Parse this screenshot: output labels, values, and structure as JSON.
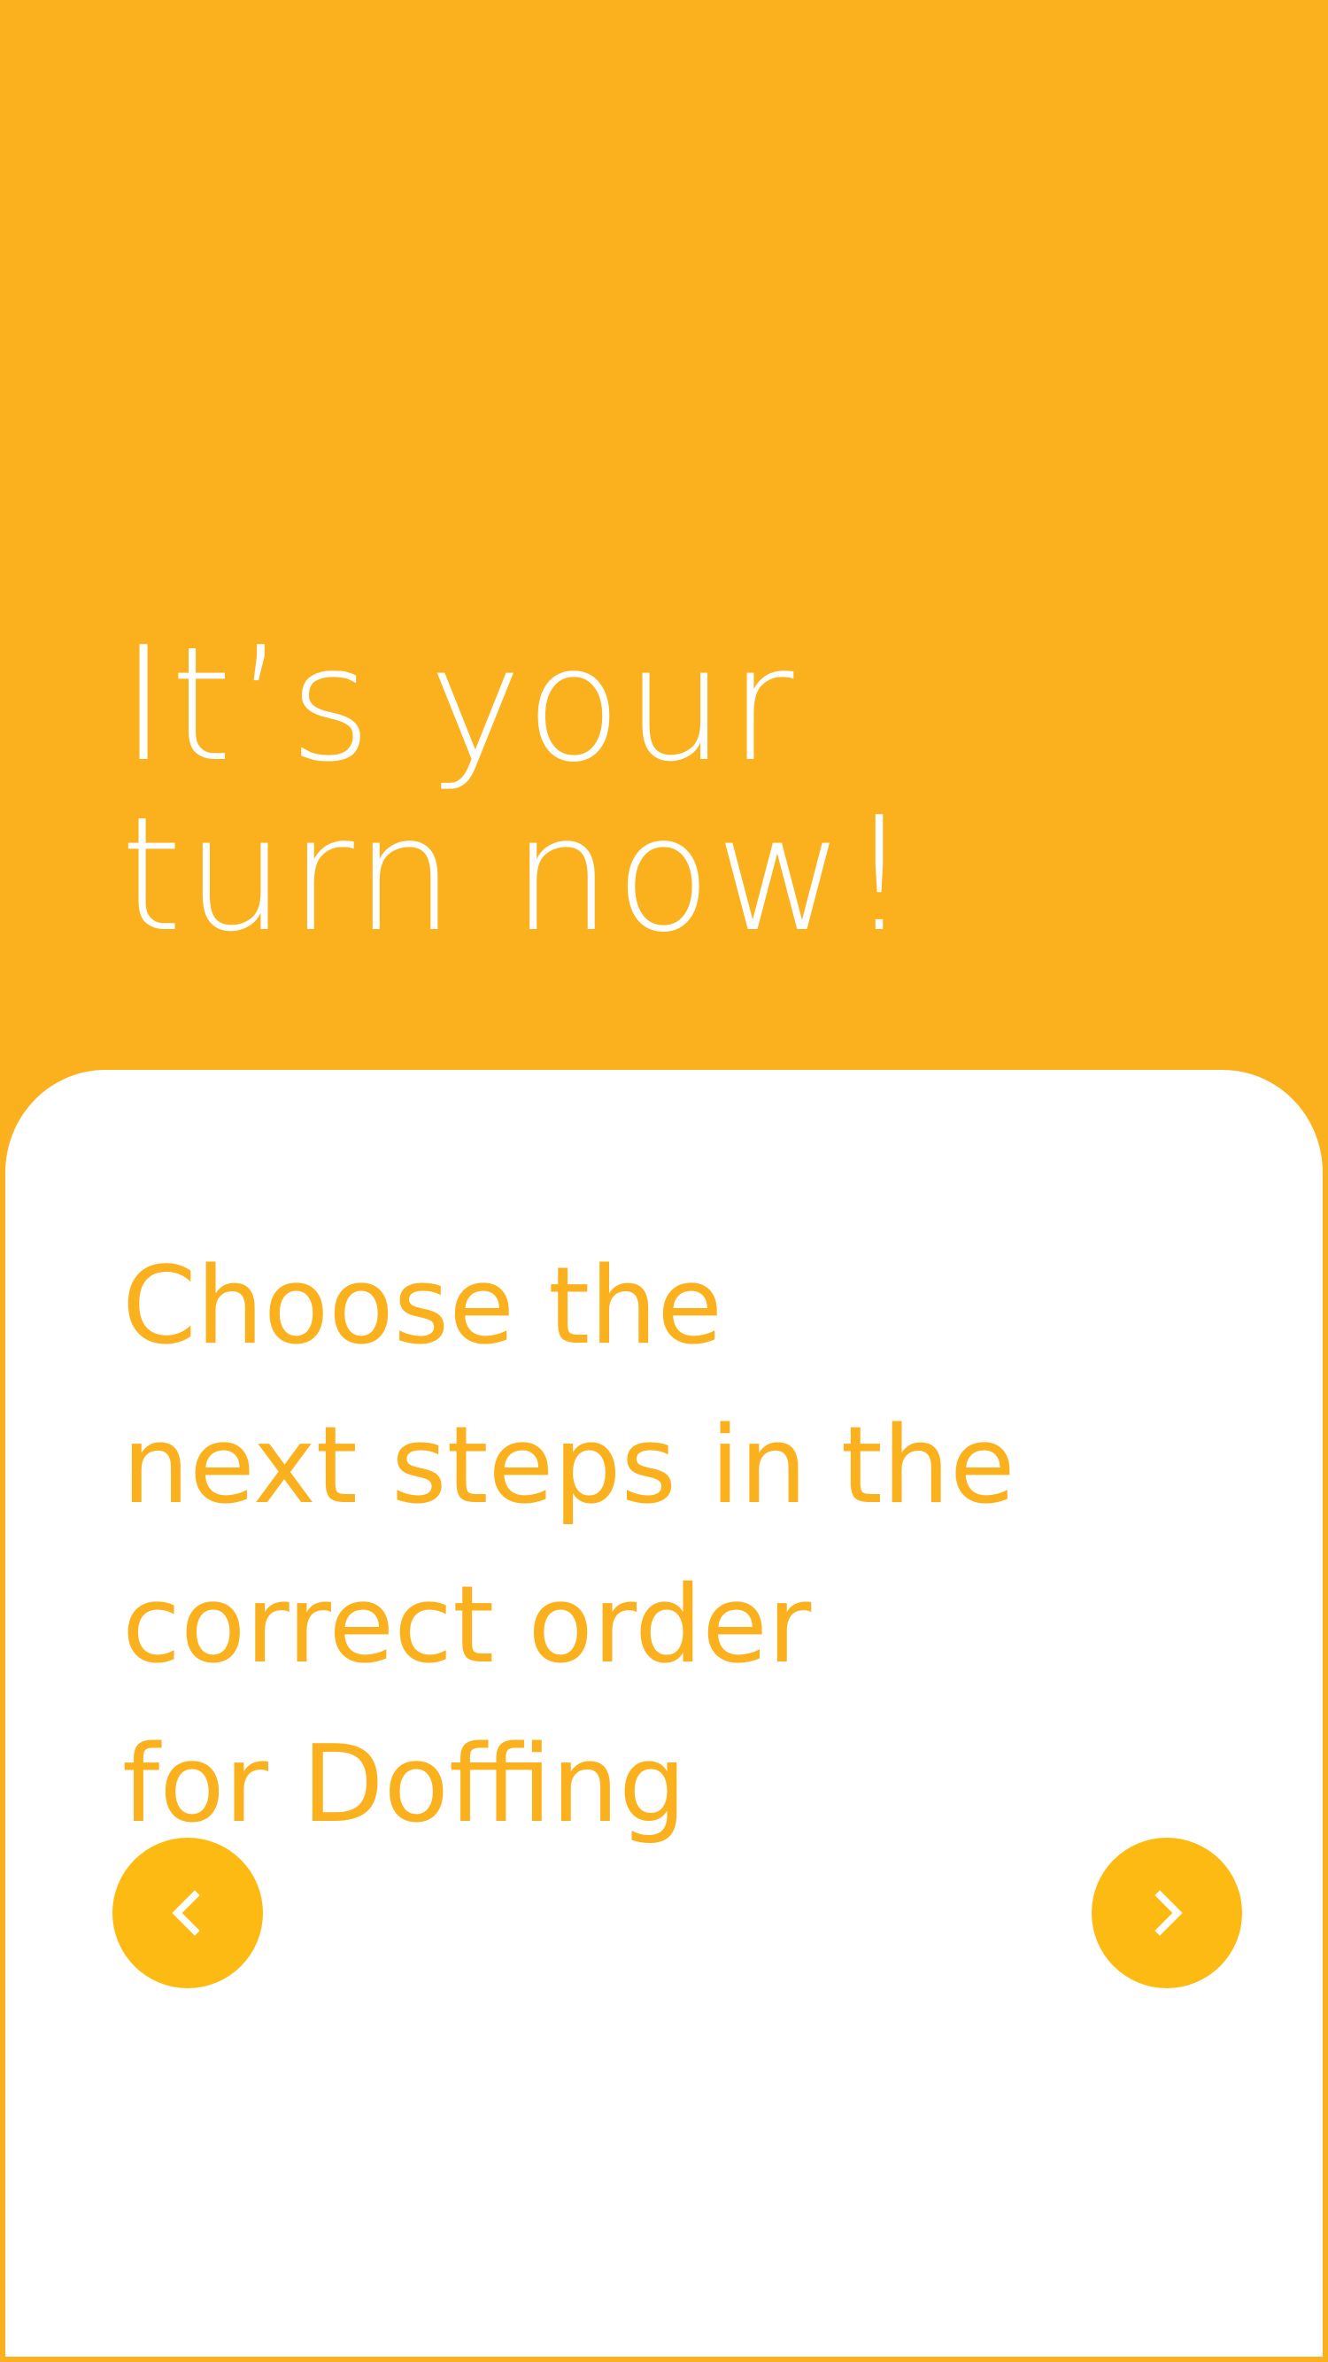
{
  "header": {
    "title": "It’s your\nturn now!"
  },
  "card": {
    "instruction": "Choose the\nnext steps in the\ncorrect order\nfor Doffing"
  },
  "navigation": {
    "previous_icon": "chevron-left-icon",
    "next_icon": "chevron-right-icon"
  },
  "colors": {
    "background": "#FBB11E",
    "card": "#FFFFFF",
    "button": "#FDBA12"
  }
}
